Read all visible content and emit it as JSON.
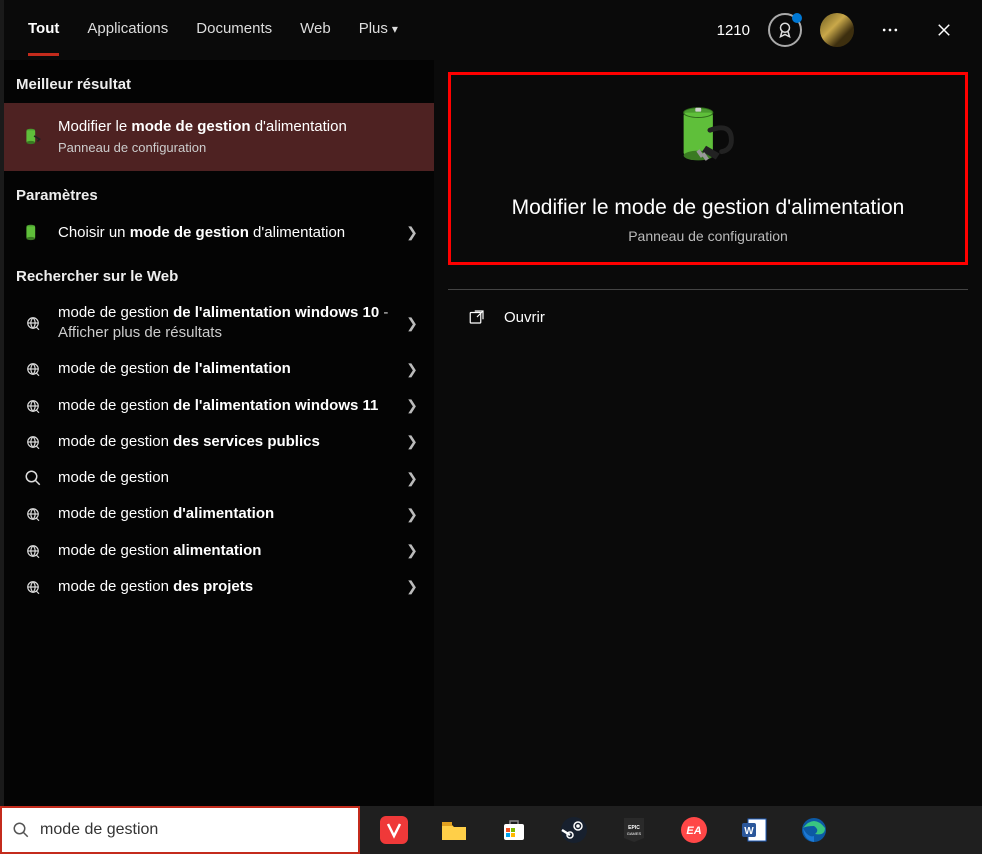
{
  "tabs": {
    "all": "Tout",
    "apps": "Applications",
    "docs": "Documents",
    "web": "Web",
    "more": "Plus"
  },
  "topright": {
    "points": "1210"
  },
  "sections": {
    "best": "Meilleur résultat",
    "settings": "Paramètres",
    "web": "Rechercher sur le Web"
  },
  "best_result": {
    "line": "Modifier le ",
    "bold": "mode de gestion",
    "line2": " d'alimentation",
    "sub": "Panneau de configuration"
  },
  "settings_result": {
    "line": "Choisir un ",
    "bold": "mode de gestion",
    "line2": " d'alimentation"
  },
  "web_results": [
    {
      "pre": "mode de gestion ",
      "bold": "de l'alimentation windows 10",
      "suffix": " - Afficher plus de résultats",
      "icon": "globe"
    },
    {
      "pre": "mode de gestion ",
      "bold": "de l'alimentation",
      "suffix": "",
      "icon": "globe"
    },
    {
      "pre": "mode de gestion ",
      "bold": "de l'alimentation windows 11",
      "suffix": "",
      "icon": "globe"
    },
    {
      "pre": "mode de gestion ",
      "bold": "des services publics",
      "suffix": "",
      "icon": "globe"
    },
    {
      "pre": "mode de gestion",
      "bold": "",
      "suffix": "",
      "icon": "search"
    },
    {
      "pre": "mode de gestion ",
      "bold": "d'alimentation",
      "suffix": "",
      "icon": "globe"
    },
    {
      "pre": "mode de gestion ",
      "bold": "alimentation",
      "suffix": "",
      "icon": "globe"
    },
    {
      "pre": "mode de gestion ",
      "bold": "des projets",
      "suffix": "",
      "icon": "globe"
    }
  ],
  "preview": {
    "title": "Modifier le mode de gestion d'alimentation",
    "sub": "Panneau de configuration",
    "open": "Ouvrir"
  },
  "search": {
    "value": "mode de gestion"
  }
}
